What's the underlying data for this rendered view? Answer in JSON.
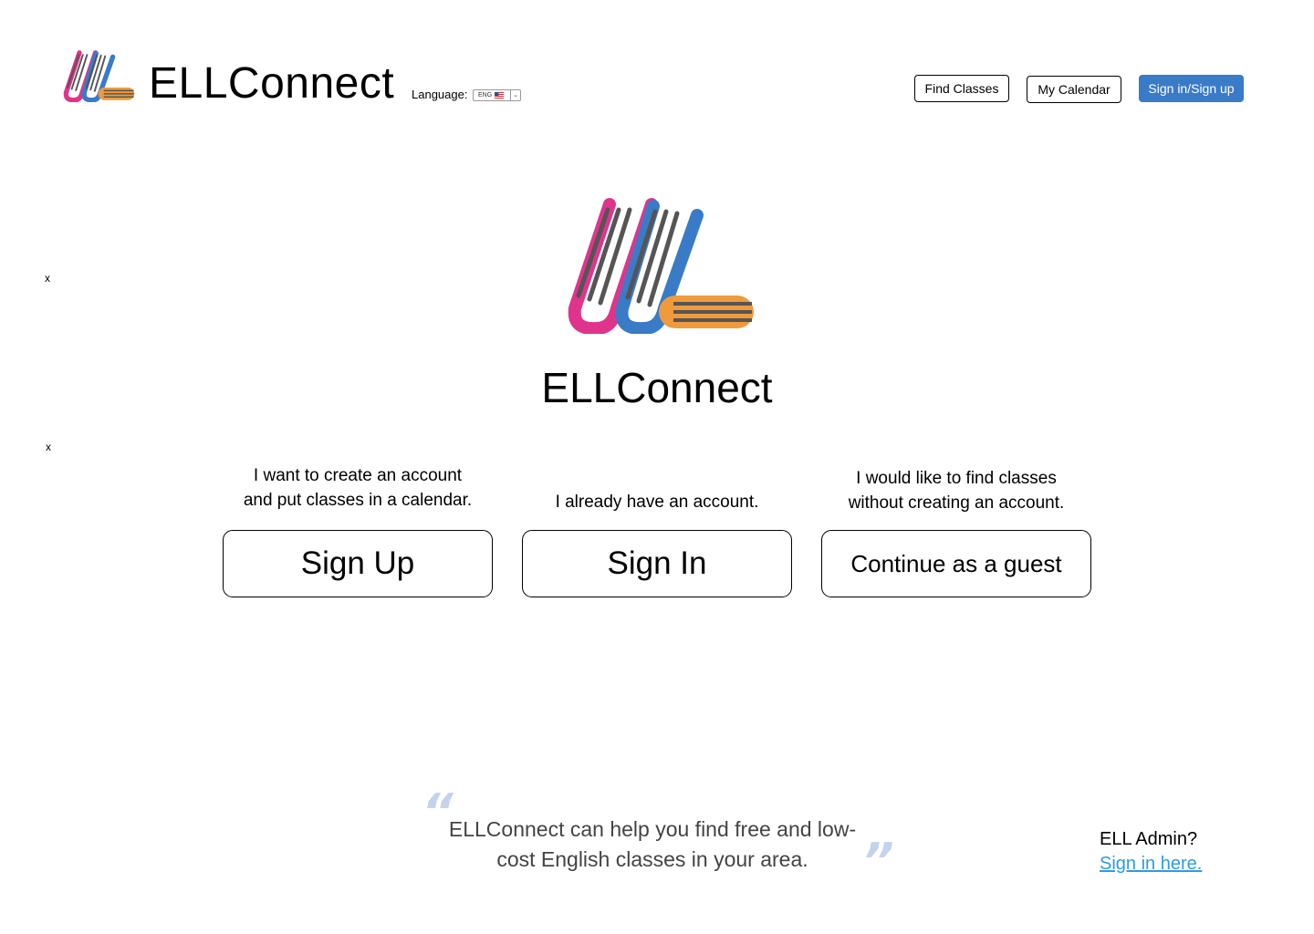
{
  "header": {
    "brand": "ELLConnect",
    "language_label": "Language:",
    "language_value": "ENG",
    "language_flag_icon": "us-flag-icon",
    "nav": {
      "find_classes": "Find Classes",
      "my_calendar": "My Calendar",
      "sign_in_up": "Sign in/Sign up"
    },
    "accent_color": "#3a7bc8"
  },
  "close_marks": [
    "x",
    "x"
  ],
  "hero": {
    "title": "ELLConnect",
    "logo_colors": {
      "pink": "#e0348c",
      "blue": "#3a7bc8",
      "orange": "#ef9a3c",
      "stripes": "#555555"
    }
  },
  "options": {
    "sign_up": {
      "description": "I want to create an account and put classes in a calendar.",
      "button": "Sign Up"
    },
    "sign_in": {
      "description": "I already have an account.",
      "button": "Sign In"
    },
    "guest": {
      "description": "I would like to find classes without creating an account.",
      "button": "Continue as a guest"
    }
  },
  "quote": {
    "open_mark": "“",
    "close_mark": "”",
    "text": "ELLConnect can help you find free and low-cost English classes in your area."
  },
  "admin": {
    "question": "ELL Admin?",
    "link": "Sign in here.",
    "link_color": "#2e9be6"
  }
}
